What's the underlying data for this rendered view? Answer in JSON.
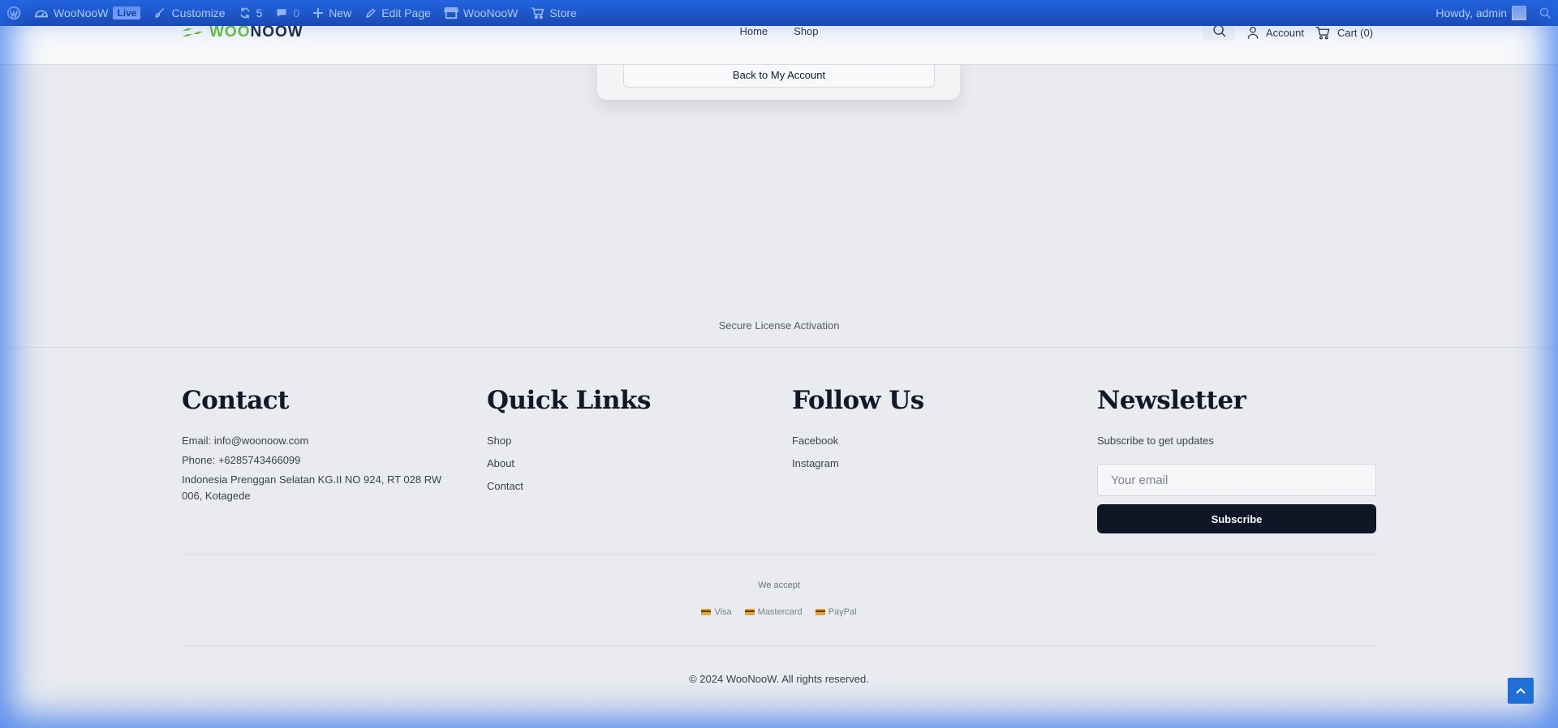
{
  "adminbar": {
    "site_name": "WooNooW",
    "live_badge": "Live",
    "customize": "Customize",
    "updates_count": "5",
    "comments_count": "0",
    "new": "New",
    "edit_page": "Edit Page",
    "woonoow": "WooNooW",
    "store": "Store",
    "howdy": "Howdy, admin"
  },
  "header": {
    "logo_part1": "WOO",
    "logo_part2": "NOOW",
    "nav": [
      "Home",
      "Shop"
    ],
    "account": "Account",
    "cart": "Cart (0)"
  },
  "card": {
    "back_button": "Back to My Account"
  },
  "secure_text": "Secure License Activation",
  "footer": {
    "contact": {
      "title": "Contact",
      "email": "Email: info@woonoow.com",
      "phone": "Phone: +6285743466099",
      "address": "Indonesia Prenggan Selatan KG.II NO 924, RT 028 RW 006, Kotagede"
    },
    "quick_links": {
      "title": "Quick Links",
      "links": [
        "Shop",
        "About",
        "Contact"
      ]
    },
    "follow": {
      "title": "Follow Us",
      "links": [
        "Facebook",
        "Instagram"
      ]
    },
    "newsletter": {
      "title": "Newsletter",
      "subtitle": "Subscribe to get updates",
      "placeholder": "Your email",
      "button": "Subscribe"
    },
    "we_accept": "We accept",
    "payments": [
      "Visa",
      "Mastercard",
      "PayPal"
    ],
    "copyright": "© 2024 WooNooW. All rights reserved."
  },
  "colors": {
    "adminbar": "#1d55c9",
    "accent_green": "#6cbf3a",
    "subscribe_button": "#0f1726",
    "scroll_top": "#1f6fd6"
  }
}
